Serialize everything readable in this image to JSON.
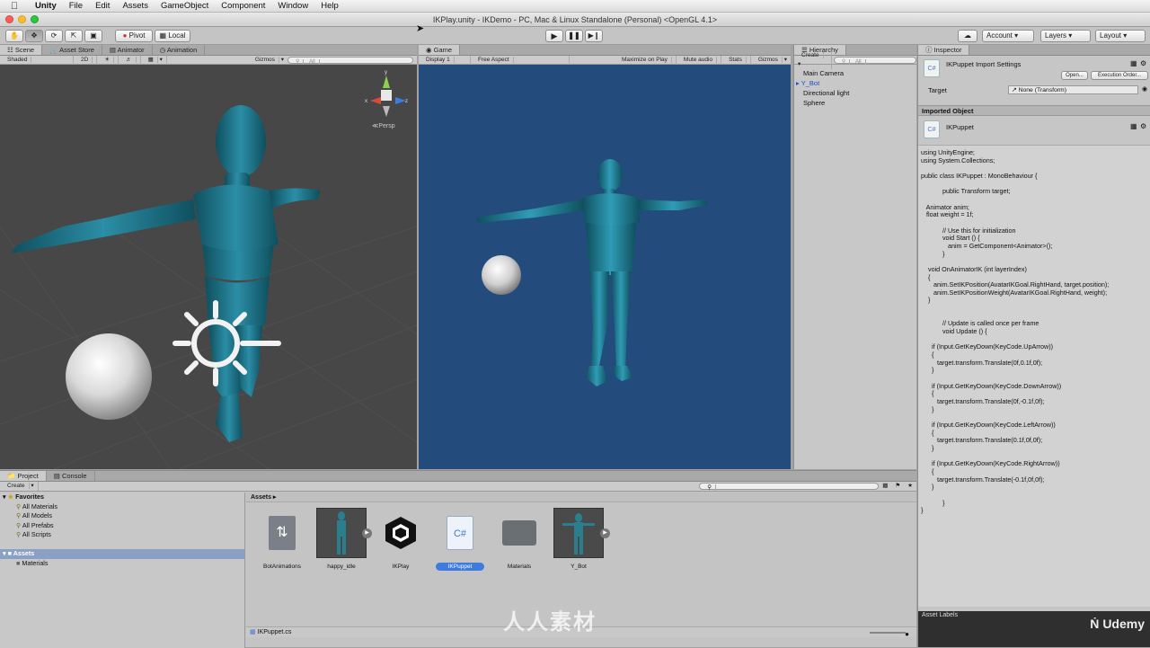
{
  "menubar": {
    "items": [
      "Unity",
      "File",
      "Edit",
      "Assets",
      "GameObject",
      "Component",
      "Window",
      "Help"
    ]
  },
  "window": {
    "title": "IKPlay.unity - IKDemo - PC, Mac & Linux Standalone (Personal) <OpenGL 4.1>"
  },
  "toolbar": {
    "pivot": "Pivot",
    "local": "Local",
    "account": "Account",
    "layers": "Layers",
    "layout": "Layout"
  },
  "scene": {
    "tabs": [
      "Scene",
      "Asset Store",
      "Animator",
      "Animation"
    ],
    "shading": "Shaded",
    "mode2d": "2D",
    "gizmos": "Gizmos",
    "search_placeholder": "All",
    "persp_label": "Persp",
    "gizmo_axes": {
      "y": "y",
      "x": "x",
      "z": "z"
    }
  },
  "game": {
    "tab": "Game",
    "display": "Display 1",
    "aspect": "Free Aspect",
    "maximize": "Maximize on Play",
    "mute": "Mute audio",
    "stats": "Stats",
    "gizmos": "Gizmos"
  },
  "hierarchy": {
    "tab": "Hierarchy",
    "create": "Create",
    "search_placeholder": "All",
    "items": [
      "Main Camera",
      "Y_Bot",
      "Directional light",
      "Sphere"
    ]
  },
  "inspector": {
    "tab": "Inspector",
    "title": "IKPuppet Import Settings",
    "open_button": "Open...",
    "exec_button": "Execution Order...",
    "target_label": "Target",
    "target_value": "None (Transform)",
    "imported_object": "Imported Object",
    "script_name": "IKPuppet",
    "code_lines": [
      "using UnityEngine;",
      "using System.Collections;",
      "",
      "public class IKPuppet : MonoBehaviour {",
      "",
      "            public Transform target;",
      "",
      "   Animator anim;",
      "   float weight = 1f;",
      "",
      "            // Use this for initialization",
      "            void Start () {",
      "               anim = GetComponent<Animator>();",
      "            }",
      "",
      "    void OnAnimatorIK (int layerIndex)",
      "    {",
      "       anim.SetIKPosition(AvatarIKGoal.RightHand, target.position);",
      "       anim.SetIKPositionWeight(AvatarIKGoal.RightHand, weight);",
      "    }",
      "",
      "",
      "            // Update is called once per frame",
      "            void Update () {",
      "",
      "      if (Input.GetKeyDown(KeyCode.UpArrow))",
      "      {",
      "         target.transform.Translate(0f,0.1f,0f);",
      "      }",
      "",
      "      if (Input.GetKeyDown(KeyCode.DownArrow))",
      "      {",
      "         target.transform.Translate(0f,-0.1f,0f);",
      "      }",
      "",
      "      if (Input.GetKeyDown(KeyCode.LeftArrow))",
      "      {",
      "         target.transform.Translate(0.1f,0f,0f);",
      "      }",
      "",
      "      if (Input.GetKeyDown(KeyCode.RightArrow))",
      "      {",
      "         target.transform.Translate(-0.1f,0f,0f);",
      "      }",
      "",
      "            }",
      "}"
    ],
    "asset_labels": "Asset Labels"
  },
  "project": {
    "tabs": [
      "Project",
      "Console"
    ],
    "create": "Create",
    "favorites_label": "Favorites",
    "favorites": [
      "All Materials",
      "All Models",
      "All Prefabs",
      "All Scripts"
    ],
    "assets_label": "Assets",
    "assets_children": [
      "Materials"
    ],
    "breadcrumb": "Assets",
    "items": [
      "BotAnimations",
      "happy_idle",
      "IKPlay",
      "IKPuppet",
      "Materials",
      "Y_Bot"
    ],
    "selected_file": "IKPuppet.cs"
  },
  "watermarks": {
    "center": "人人素材",
    "brand": "Udemy"
  },
  "colors": {
    "game_bg": "#234c7d",
    "scene_bg": "#474747",
    "selection": "#3d7be0",
    "robot": "#1a7a90"
  }
}
